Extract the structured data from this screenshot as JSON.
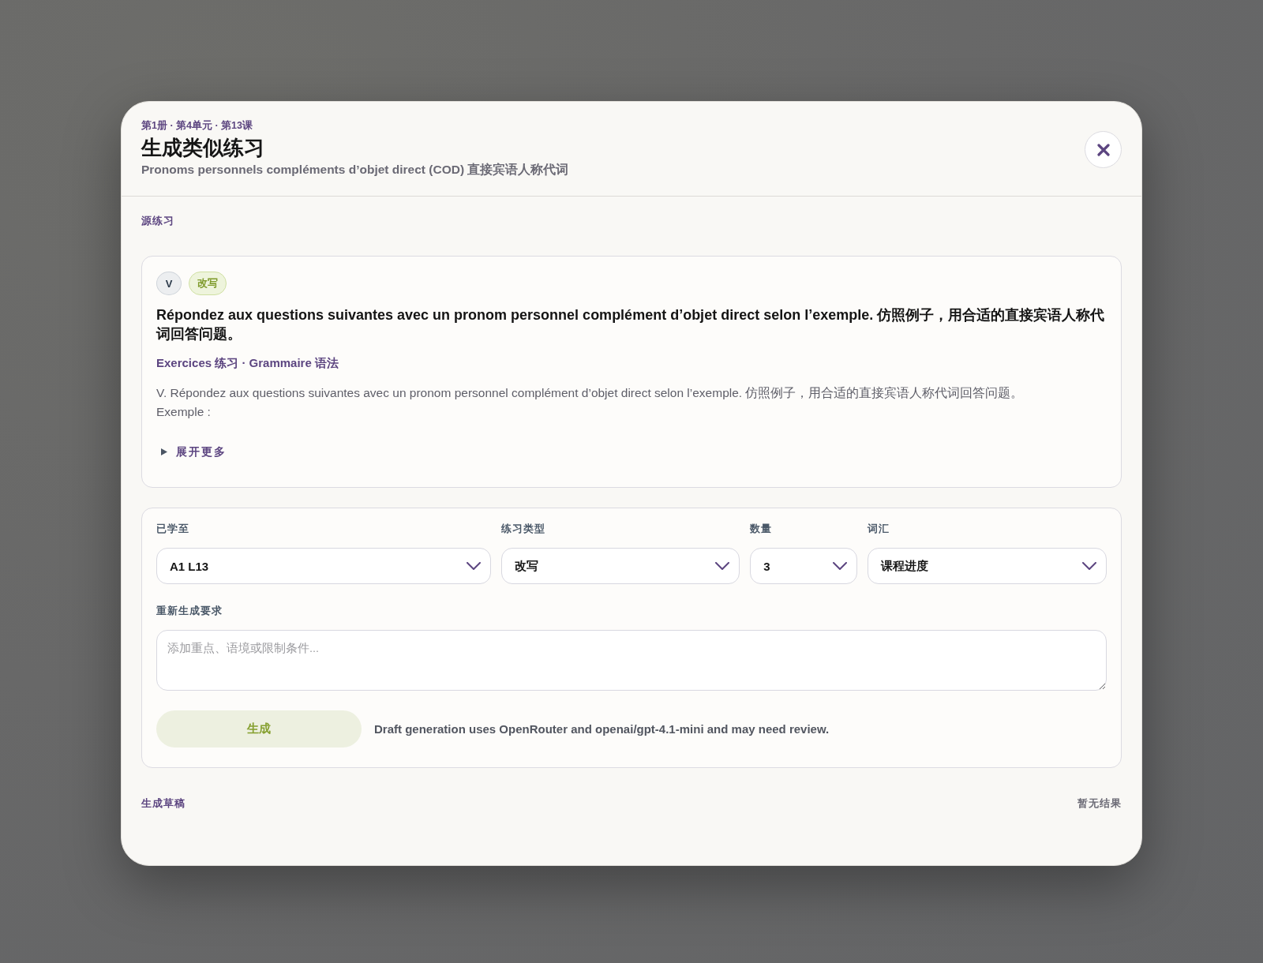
{
  "dialog": {
    "breadcrumb": "第1册 · 第4单元 · 第13课",
    "title": "生成类似练习",
    "subtitle": "Pronoms personnels compléments d’objet direct (COD) 直接宾语人称代词"
  },
  "source_section": {
    "label": "源练习",
    "card": {
      "badges": [
        {
          "text": "V",
          "kind": "number"
        },
        {
          "text": "改写",
          "kind": "type"
        }
      ],
      "heading": "Répondez aux questions suivantes avec un pronom personnel complément d’objet direct selon l’exemple. 仿照例子，用合适的直接宾语人称代词回答问题。",
      "meta": "Exercices 练习 · Grammaire 语法",
      "description": "V. Répondez aux questions suivantes avec un pronom personnel complément d’objet direct selon l’exemple. 仿照例子，用合适的直接宾语人称代词回答问题。\nExemple :",
      "expander": {
        "label": "展开更多",
        "expanded": false
      }
    }
  },
  "form": {
    "fields": [
      {
        "label": "已学至",
        "value": "A1 L13"
      },
      {
        "label": "练习类型",
        "value": "改写"
      },
      {
        "label": "数量",
        "value": "3"
      },
      {
        "label": "词汇",
        "value": "课程进度"
      }
    ],
    "request": {
      "label": "重新生成要求",
      "placeholder": "添加重点、语境或限制条件..."
    },
    "generate_button": {
      "label": "生成",
      "disabled": true
    },
    "note": "Draft generation uses OpenRouter and openai/gpt-4.1-mini and may need review."
  },
  "drafts": {
    "label": "生成草稿",
    "status": "暂无结果"
  }
}
